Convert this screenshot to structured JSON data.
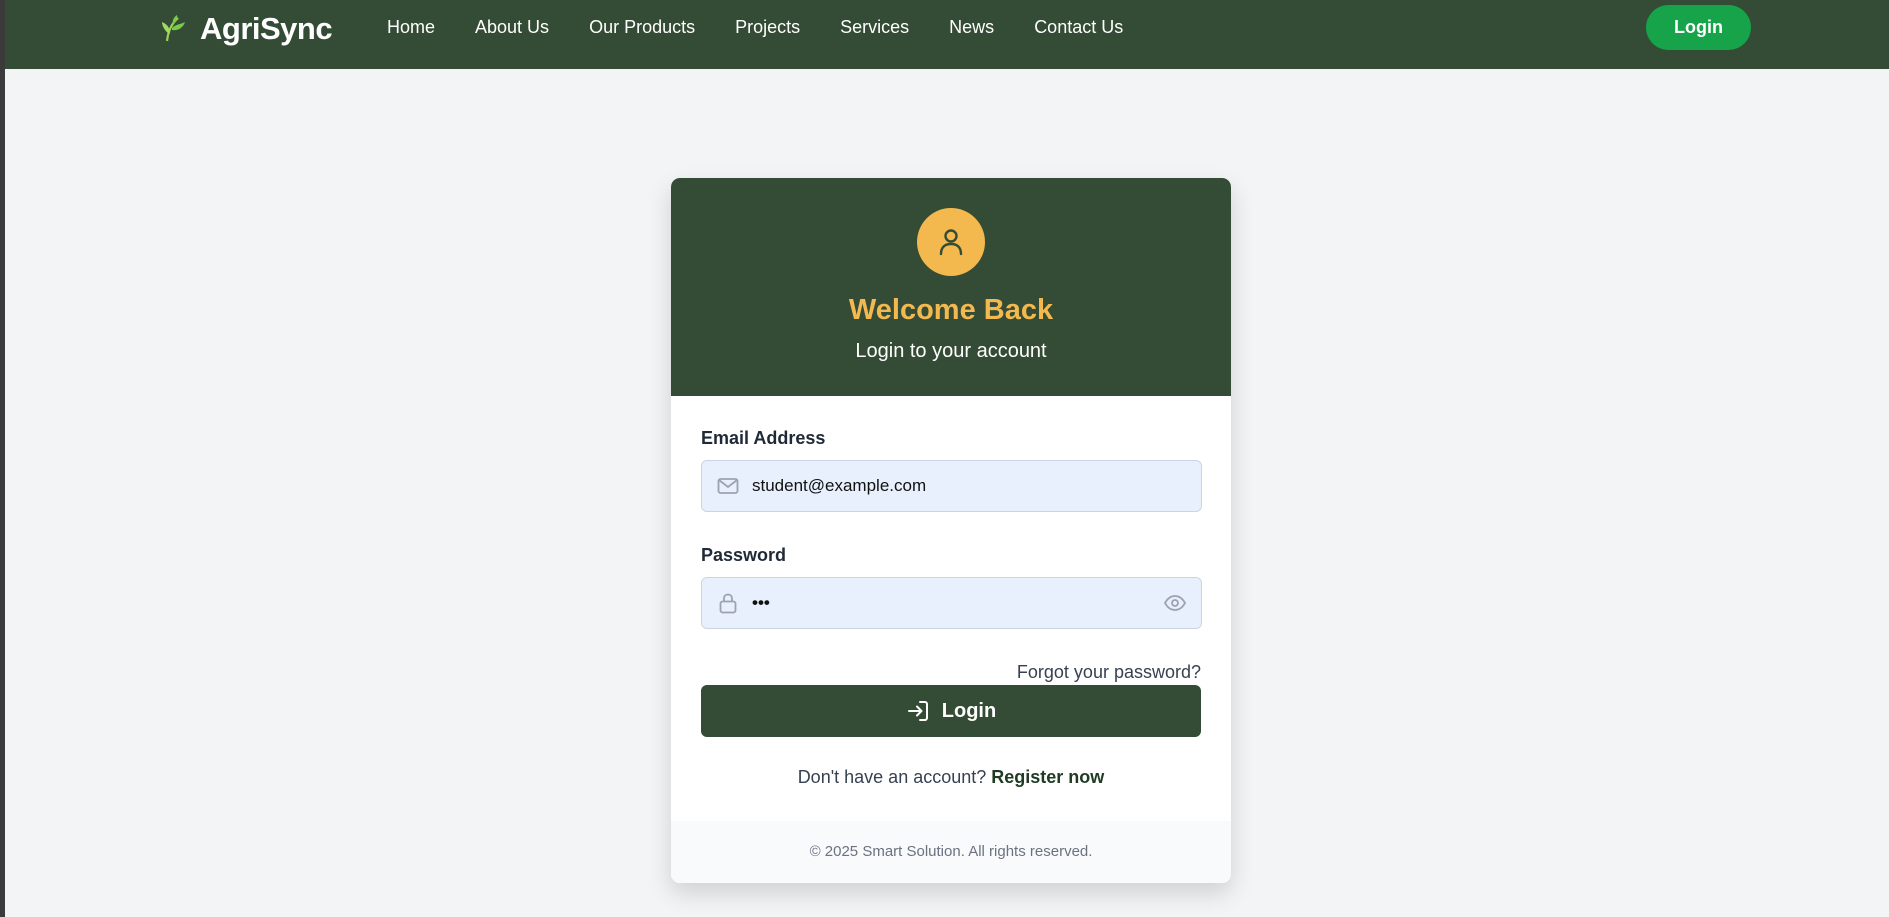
{
  "app": {
    "brand_name": "AgriSync",
    "brand_icon": "leaf-icon"
  },
  "nav": {
    "items": [
      "Home",
      "About Us",
      "Our Products",
      "Projects",
      "Services",
      "News",
      "Contact Us"
    ],
    "login_label": "Login"
  },
  "login_card": {
    "avatar_icon": "user-icon",
    "title": "Welcome Back",
    "subtitle": "Login to your account",
    "email": {
      "label": "Email Address",
      "value": "student@example.com",
      "icon": "mail-icon"
    },
    "password": {
      "label": "Password",
      "value": "•••",
      "icon": "lock-icon",
      "toggle_icon": "eye-icon"
    },
    "forgot_label": "Forgot your password?",
    "submit_label": "Login",
    "submit_icon": "login-arrow-icon",
    "register_prompt": "Don't have an account?",
    "register_link": "Register now",
    "footer": "© 2025 Smart Solution. All rights reserved."
  },
  "colors": {
    "primary_green": "#344b35",
    "accent_gold": "#f4b94e",
    "cta_green": "#16a34a",
    "input_bg": "#e8f0fe",
    "page_bg": "#f3f4f6"
  }
}
